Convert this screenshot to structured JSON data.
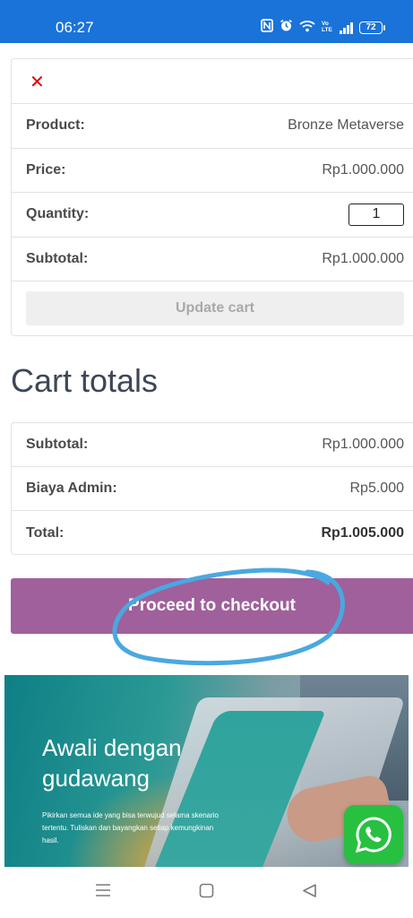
{
  "status_bar": {
    "time": "06:27",
    "icons": [
      "nfc-icon",
      "alarm-icon",
      "wifi-icon",
      "volte-icon",
      "signal-icon",
      "battery-icon"
    ],
    "volte_text": "Vo\nLTE",
    "battery_level": "72"
  },
  "cart": {
    "remove_icon": "close-icon",
    "remove_color": "#e00000",
    "rows": [
      {
        "label": "Product:",
        "value": "Bronze Metaverse"
      },
      {
        "label": "Price:",
        "value": "Rp1.000.000"
      },
      {
        "label": "Quantity:",
        "value": "1"
      },
      {
        "label": "Subtotal:",
        "value": "Rp1.000.000"
      }
    ],
    "update_button": "Update cart"
  },
  "cart_totals": {
    "title": "Cart totals",
    "rows": [
      {
        "label": "Subtotal:",
        "value": "Rp1.000.000"
      },
      {
        "label": "Biaya Admin:",
        "value": "Rp5.000"
      },
      {
        "label": "Total:",
        "value": "Rp1.005.000"
      }
    ],
    "checkout_button": "Proceed to checkout",
    "checkout_color": "#a0609b",
    "annotation_color": "#4aa8e0"
  },
  "banner": {
    "title": "Awali dengan\ngudawang",
    "text": "Pikirkan semua ide yang bisa terwujud selama skenario tertentu. Tuliskan dan bayangkan setiap kemungkinan hasil.",
    "whatsapp_icon": "whatsapp-icon",
    "whatsapp_color": "#28c041"
  },
  "nav_bar": {
    "icons": [
      "menu-icon",
      "home-icon",
      "back-icon"
    ]
  }
}
